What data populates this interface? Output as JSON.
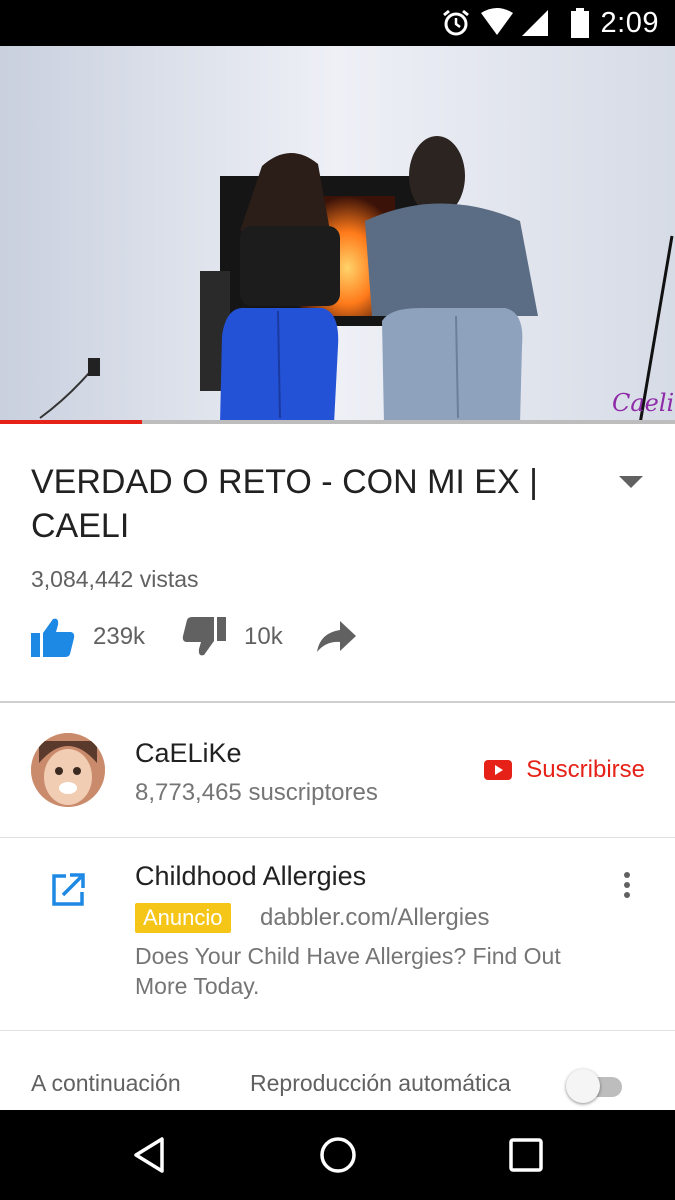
{
  "status_bar": {
    "time": "2:09",
    "icons": [
      "alarm-icon",
      "wifi-icon",
      "signal-icon",
      "battery-icon"
    ]
  },
  "video": {
    "watermark": "Caeli",
    "progress": 0.21
  },
  "video_info": {
    "title": "VERDAD O RETO - CON MI EX | CAELI",
    "views": "3,084,442 vistas",
    "likes": "239k",
    "dislikes": "10k"
  },
  "channel": {
    "name": "CaELiKe",
    "subscribers": "8,773,465 suscriptores",
    "subscribe_label": "Suscribirse"
  },
  "ad": {
    "title": "Childhood Allergies",
    "badge": "Anuncio",
    "url": "dabbler.com/Allergies",
    "description": "Does Your Child Have Allergies? Find Out More Today."
  },
  "up_next": {
    "label": "A continuación",
    "autoplay_label": "Reproducción automática",
    "autoplay_on": false
  },
  "colors": {
    "accent_red": "#e62117",
    "like_blue": "#1e88e5",
    "badge_yellow": "#f5c518"
  }
}
